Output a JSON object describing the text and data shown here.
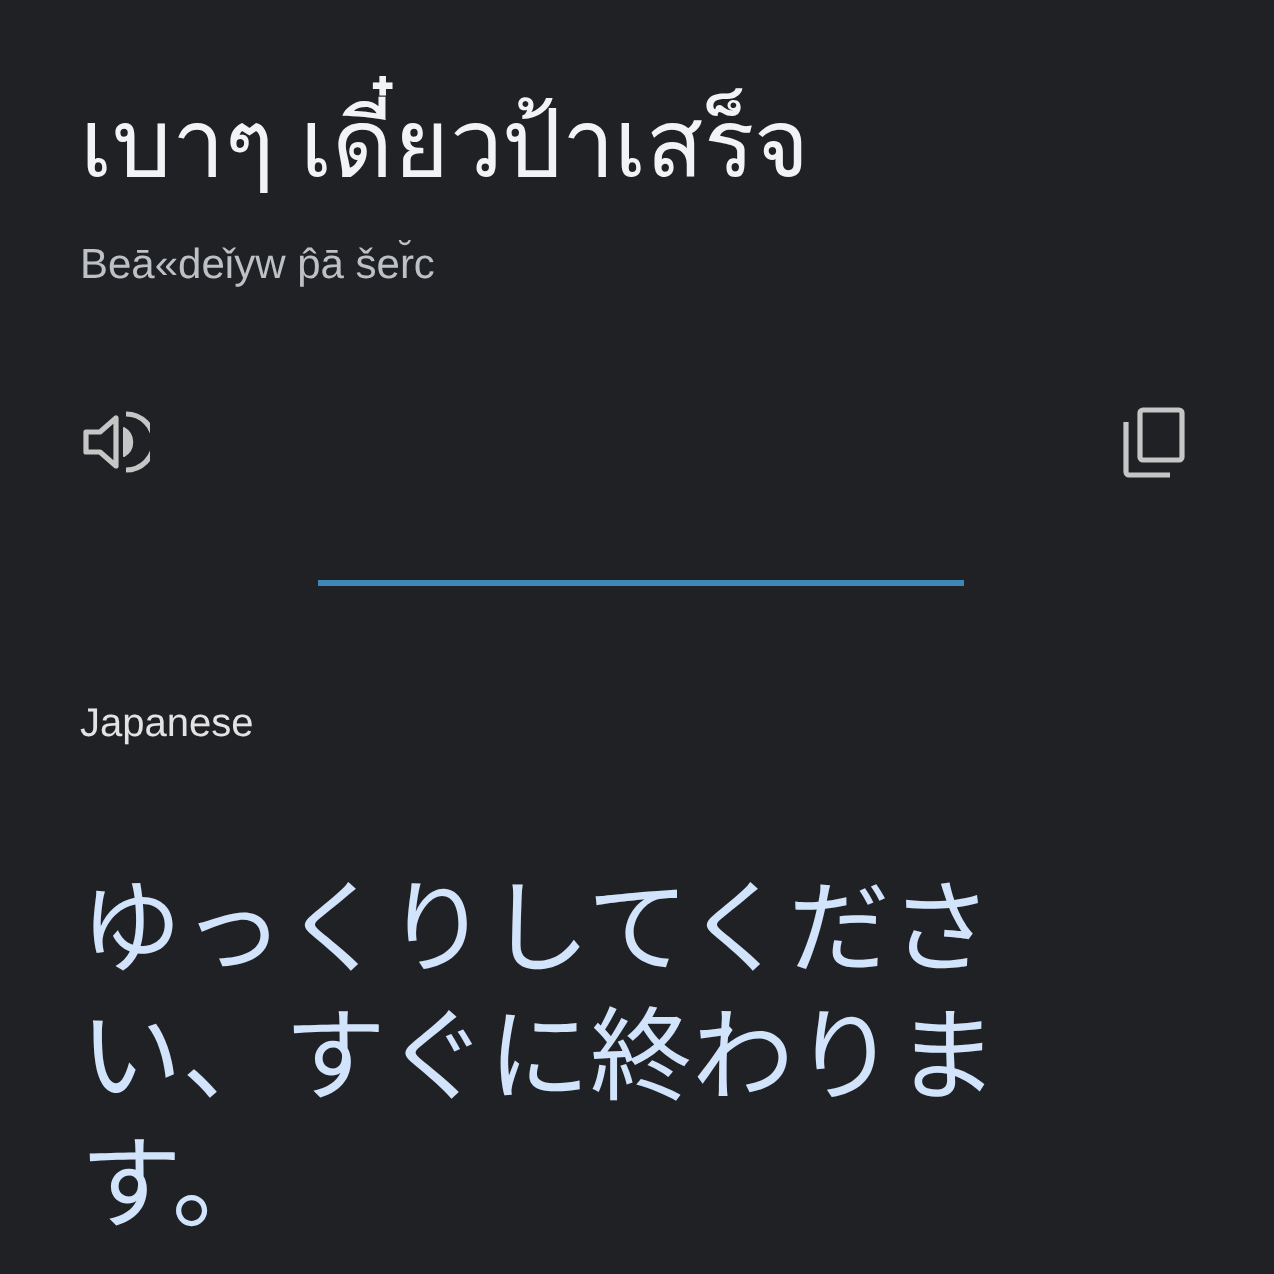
{
  "source": {
    "text": "เบาๆ เดี๋ยวป้าเสร็จ",
    "transliteration": "Beā«deǐyw p̂ā šer̆c"
  },
  "actions": [
    {
      "kind": "speaker"
    },
    {
      "kind": "copy"
    }
  ],
  "target": {
    "language": "Japanese",
    "text": "ゆっくりしてください、すぐに終わります。"
  }
}
